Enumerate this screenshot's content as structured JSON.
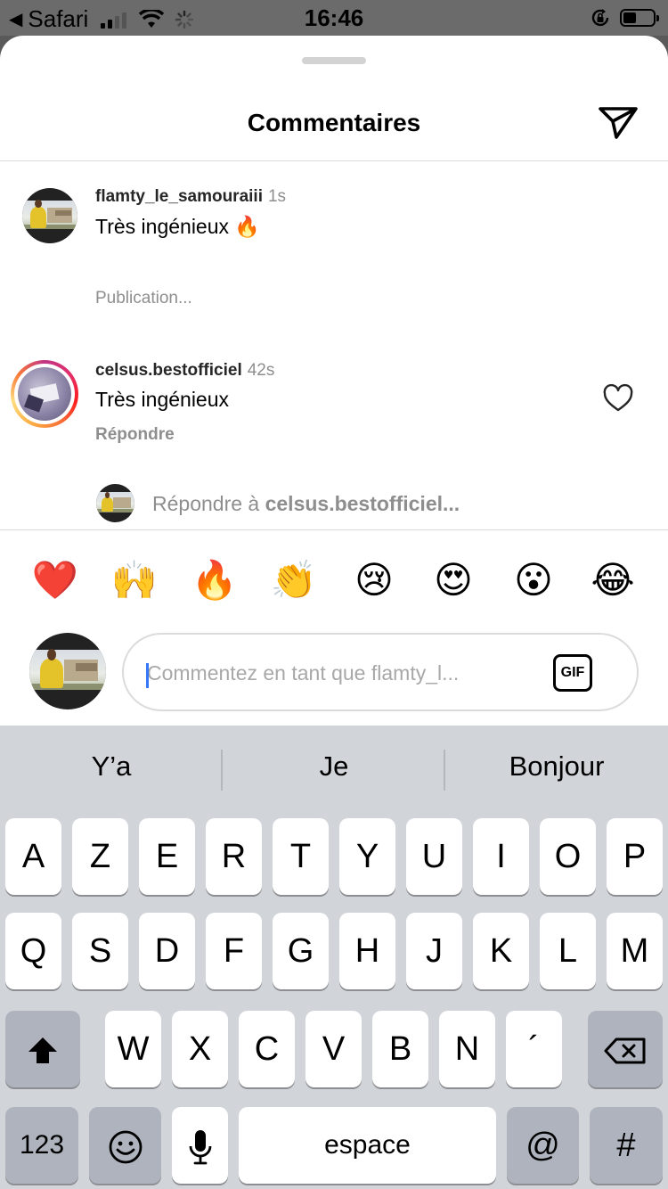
{
  "status_bar": {
    "back_app": "Safari",
    "time": "16:46"
  },
  "sheet": {
    "title": "Commentaires",
    "share_icon": "paper-plane-icon"
  },
  "comments": [
    {
      "username": "flamty_le_samouraiii",
      "time": "1s",
      "text": "Très ingénieux 🔥",
      "status": "Publication..."
    },
    {
      "username": "celsus.bestofficiel",
      "time": "42s",
      "text": "Très ingénieux",
      "action": "Répondre",
      "like_icon": "heart-outline-icon"
    }
  ],
  "reply_prompt": {
    "prefix": "Répondre à ",
    "target": "celsus.bestofficiel..."
  },
  "emoji_bar": [
    "❤️",
    "🙌",
    "🔥",
    "👏",
    "😢",
    "😍",
    "😮",
    "😂"
  ],
  "comment_input": {
    "placeholder": "Commentez en tant que flamty_l...",
    "gif_label": "GIF"
  },
  "keyboard": {
    "suggestions": [
      "Y’a",
      "Je",
      "Bonjour"
    ],
    "row1": [
      "A",
      "Z",
      "E",
      "R",
      "T",
      "Y",
      "U",
      "I",
      "O",
      "P"
    ],
    "row2": [
      "Q",
      "S",
      "D",
      "F",
      "G",
      "H",
      "J",
      "K",
      "L",
      "M"
    ],
    "row3": [
      "W",
      "X",
      "C",
      "V",
      "B",
      "N",
      "´"
    ],
    "numbers_key": "123",
    "space_key": "espace",
    "at_key": "@",
    "hash_key": "#"
  }
}
